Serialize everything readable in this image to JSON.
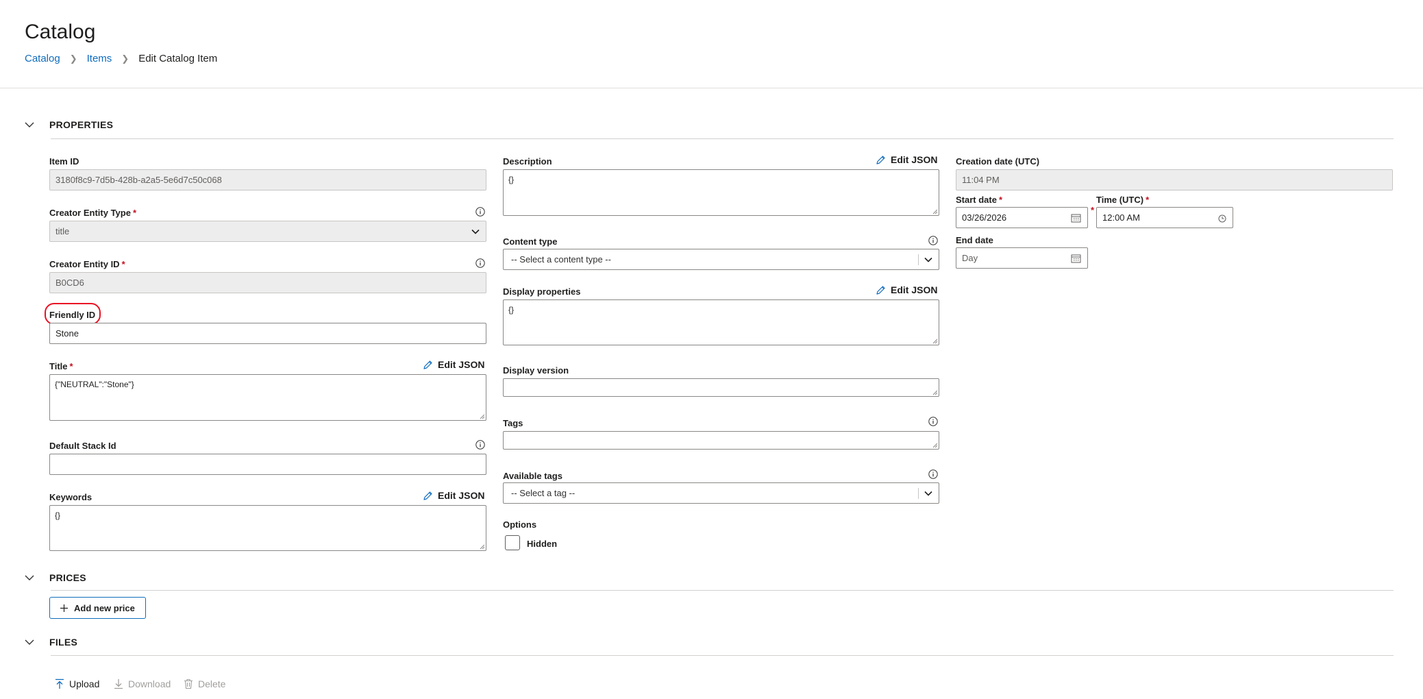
{
  "header": {
    "title": "Catalog",
    "breadcrumb": [
      "Catalog",
      "Items",
      "Edit Catalog Item"
    ]
  },
  "sections": {
    "properties": "PROPERTIES",
    "prices": "PRICES",
    "files": "FILES"
  },
  "left": {
    "item_id": {
      "label": "Item ID",
      "value": "3180f8c9-7d5b-428b-a2a5-5e6d7c50c068"
    },
    "creator_entity_type": {
      "label": "Creator Entity Type",
      "value": "title"
    },
    "creator_entity_id": {
      "label": "Creator Entity ID",
      "value": "B0CD6"
    },
    "friendly_id": {
      "label": "Friendly ID",
      "value": "Stone"
    },
    "title": {
      "label": "Title",
      "value": "{\"NEUTRAL\":\"Stone\"}"
    },
    "default_stack_id": {
      "label": "Default Stack Id",
      "value": ""
    },
    "keywords": {
      "label": "Keywords",
      "value": "{}"
    }
  },
  "middle": {
    "description": {
      "label": "Description",
      "value": "{}"
    },
    "content_type": {
      "label": "Content type",
      "placeholder": "-- Select a content type --"
    },
    "display_properties": {
      "label": "Display properties",
      "value": "{}"
    },
    "display_version": {
      "label": "Display version",
      "value": ""
    },
    "tags": {
      "label": "Tags",
      "value": ""
    },
    "available_tags": {
      "label": "Available tags",
      "placeholder": "-- Select a tag --"
    },
    "options": {
      "label": "Options",
      "hidden_label": "Hidden",
      "hidden_checked": false
    }
  },
  "right": {
    "creation_date": {
      "label": "Creation date (UTC)",
      "value": "11:04 PM"
    },
    "start_date": {
      "label": "Start date",
      "value": "03/26/2026"
    },
    "time_utc": {
      "label": "Time (UTC)",
      "value": "12:00 AM"
    },
    "end_date": {
      "label": "End date",
      "placeholder": "Day"
    }
  },
  "common": {
    "edit_json": "Edit JSON",
    "required_mark": "*"
  },
  "prices": {
    "add_button": "Add new price"
  },
  "files": {
    "upload": "Upload",
    "download": "Download",
    "delete": "Delete"
  },
  "colors": {
    "accent": "#0f6cbd",
    "required": "#c50f1f",
    "highlight": "#e81123"
  }
}
